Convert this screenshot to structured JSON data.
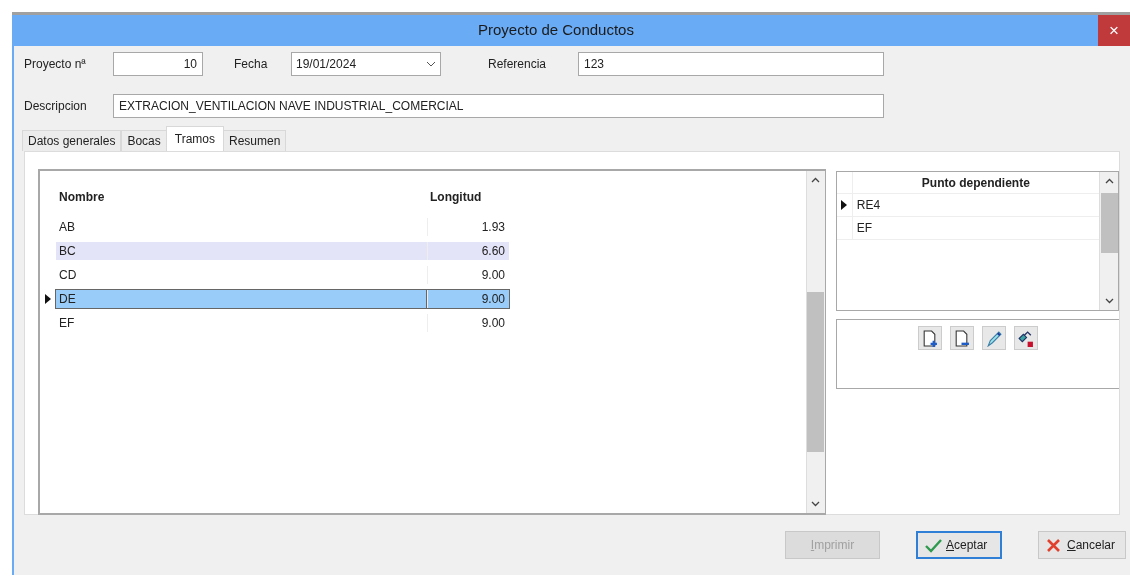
{
  "window": {
    "title": "Proyecto de Conductos",
    "close_label": "×"
  },
  "fields": [
    {
      "label": "Proyecto nª",
      "value": "10",
      "kind": "number"
    },
    {
      "label": "Fecha",
      "value": "19/01/2024",
      "kind": "date"
    },
    {
      "label": "Referencia",
      "value": "123",
      "kind": "text"
    }
  ],
  "description": {
    "label": "Descripcion",
    "value": "EXTRACION_VENTILACION NAVE INDUSTRIAL_COMERCIAL"
  },
  "tabs": [
    {
      "label": "Datos generales",
      "selected": false
    },
    {
      "label": "Bocas",
      "selected": false
    },
    {
      "label": "Tramos",
      "selected": true
    },
    {
      "label": "Resumen",
      "selected": false
    }
  ],
  "tramos_table": {
    "columns": [
      "Nombre",
      "Longitud"
    ],
    "rows": [
      {
        "cells": [
          "AB",
          "1.93"
        ],
        "selected": false,
        "highlighted": false
      },
      {
        "cells": [
          "BC",
          "6.60"
        ],
        "selected": false,
        "highlighted": true
      },
      {
        "cells": [
          "CD",
          "9.00"
        ],
        "selected": false,
        "highlighted": false
      },
      {
        "cells": [
          "DE",
          "9.00"
        ],
        "selected": true,
        "highlighted": false
      },
      {
        "cells": [
          "EF",
          "9.00"
        ],
        "selected": false,
        "highlighted": false
      }
    ]
  },
  "dependent_points": {
    "columns": [
      "Punto dependiente"
    ],
    "rows": [
      {
        "cells": [
          "RE4"
        ],
        "selected": true
      },
      {
        "cells": [
          "EF"
        ],
        "selected": false
      }
    ]
  },
  "toolbar": [
    {
      "kind": "add"
    },
    {
      "kind": "remove"
    },
    {
      "kind": "edit"
    },
    {
      "kind": "link"
    }
  ],
  "buttons": [
    {
      "label": "Imprimir",
      "kind": "print",
      "disabled": true,
      "focused": false
    },
    {
      "label": "Aceptar",
      "kind": "accept",
      "disabled": false,
      "focused": true
    },
    {
      "label": "Cancelar",
      "kind": "cancel",
      "disabled": false,
      "focused": false
    }
  ]
}
